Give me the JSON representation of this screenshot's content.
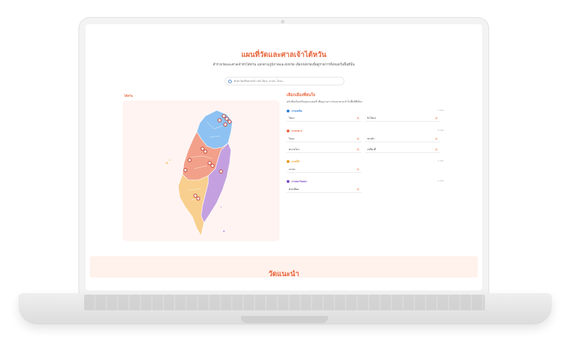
{
  "page": {
    "title": "แผนที่วัดและศาลเจ้าไต้หวัน",
    "subtitle": "สำรวจวัดและศาลเจ้าทั่วไต้หวัน แยกตามภูมิภาคและจังหวัด เลือกจังหวัดเพื่อดูรายการทั้งหมดในพื้นที่นั้น",
    "footer_title": "วัดแนะนำ"
  },
  "search": {
    "placeholder": "ค้นหาวัดหรือศาลเจ้า เช่น ไทเป, เกาสง, ไถจง..."
  },
  "map": {
    "label": "ไต้หวัน",
    "regions": [
      {
        "name": "ภาคเหนือ",
        "color": "#8ec2f2"
      },
      {
        "name": "ภาคกลาง",
        "color": "#f2a08a"
      },
      {
        "name": "ภาคใต้",
        "color": "#f8cf8e"
      },
      {
        "name": "ภาคตะวันออก",
        "color": "#c4a0e0"
      }
    ]
  },
  "list": {
    "title": "เลือกเมืองที่สนใจ",
    "description": "คลิกชื่อเมืองหรือจุดบนแผนที่ เพื่อดูรายการวัดและศาลเจ้าในพื้นที่ที่เลือก",
    "regions": [
      {
        "name": "ภาคเหนือ",
        "color": "#2f80d6",
        "count": "7 แห่ง",
        "provinces": [
          {
            "name": "ไทเป",
            "count": "5"
          },
          {
            "name": "นิวไทเป",
            "count": "2"
          }
        ]
      },
      {
        "name": "ภาคกลาง",
        "color": "#e8663d",
        "count": "6 แห่ง",
        "provinces": [
          {
            "name": "ไถจง",
            "count": "2"
          },
          {
            "name": "ชางฮั่ว",
            "count": "1"
          },
          {
            "name": "หนานโถว",
            "count": "2"
          },
          {
            "name": "เหมียวลี่",
            "count": "1"
          }
        ]
      },
      {
        "name": "ภาคใต้",
        "color": "#e89a1e",
        "count": "1 แห่ง",
        "provinces": [
          {
            "name": "เกาสง",
            "count": "1"
          }
        ]
      },
      {
        "name": "ภาคตะวันออก",
        "color": "#7c4fc4",
        "count": "1 แห่ง",
        "provinces": [
          {
            "name": "ฮัวเหลียน",
            "count": "1"
          }
        ]
      }
    ]
  }
}
